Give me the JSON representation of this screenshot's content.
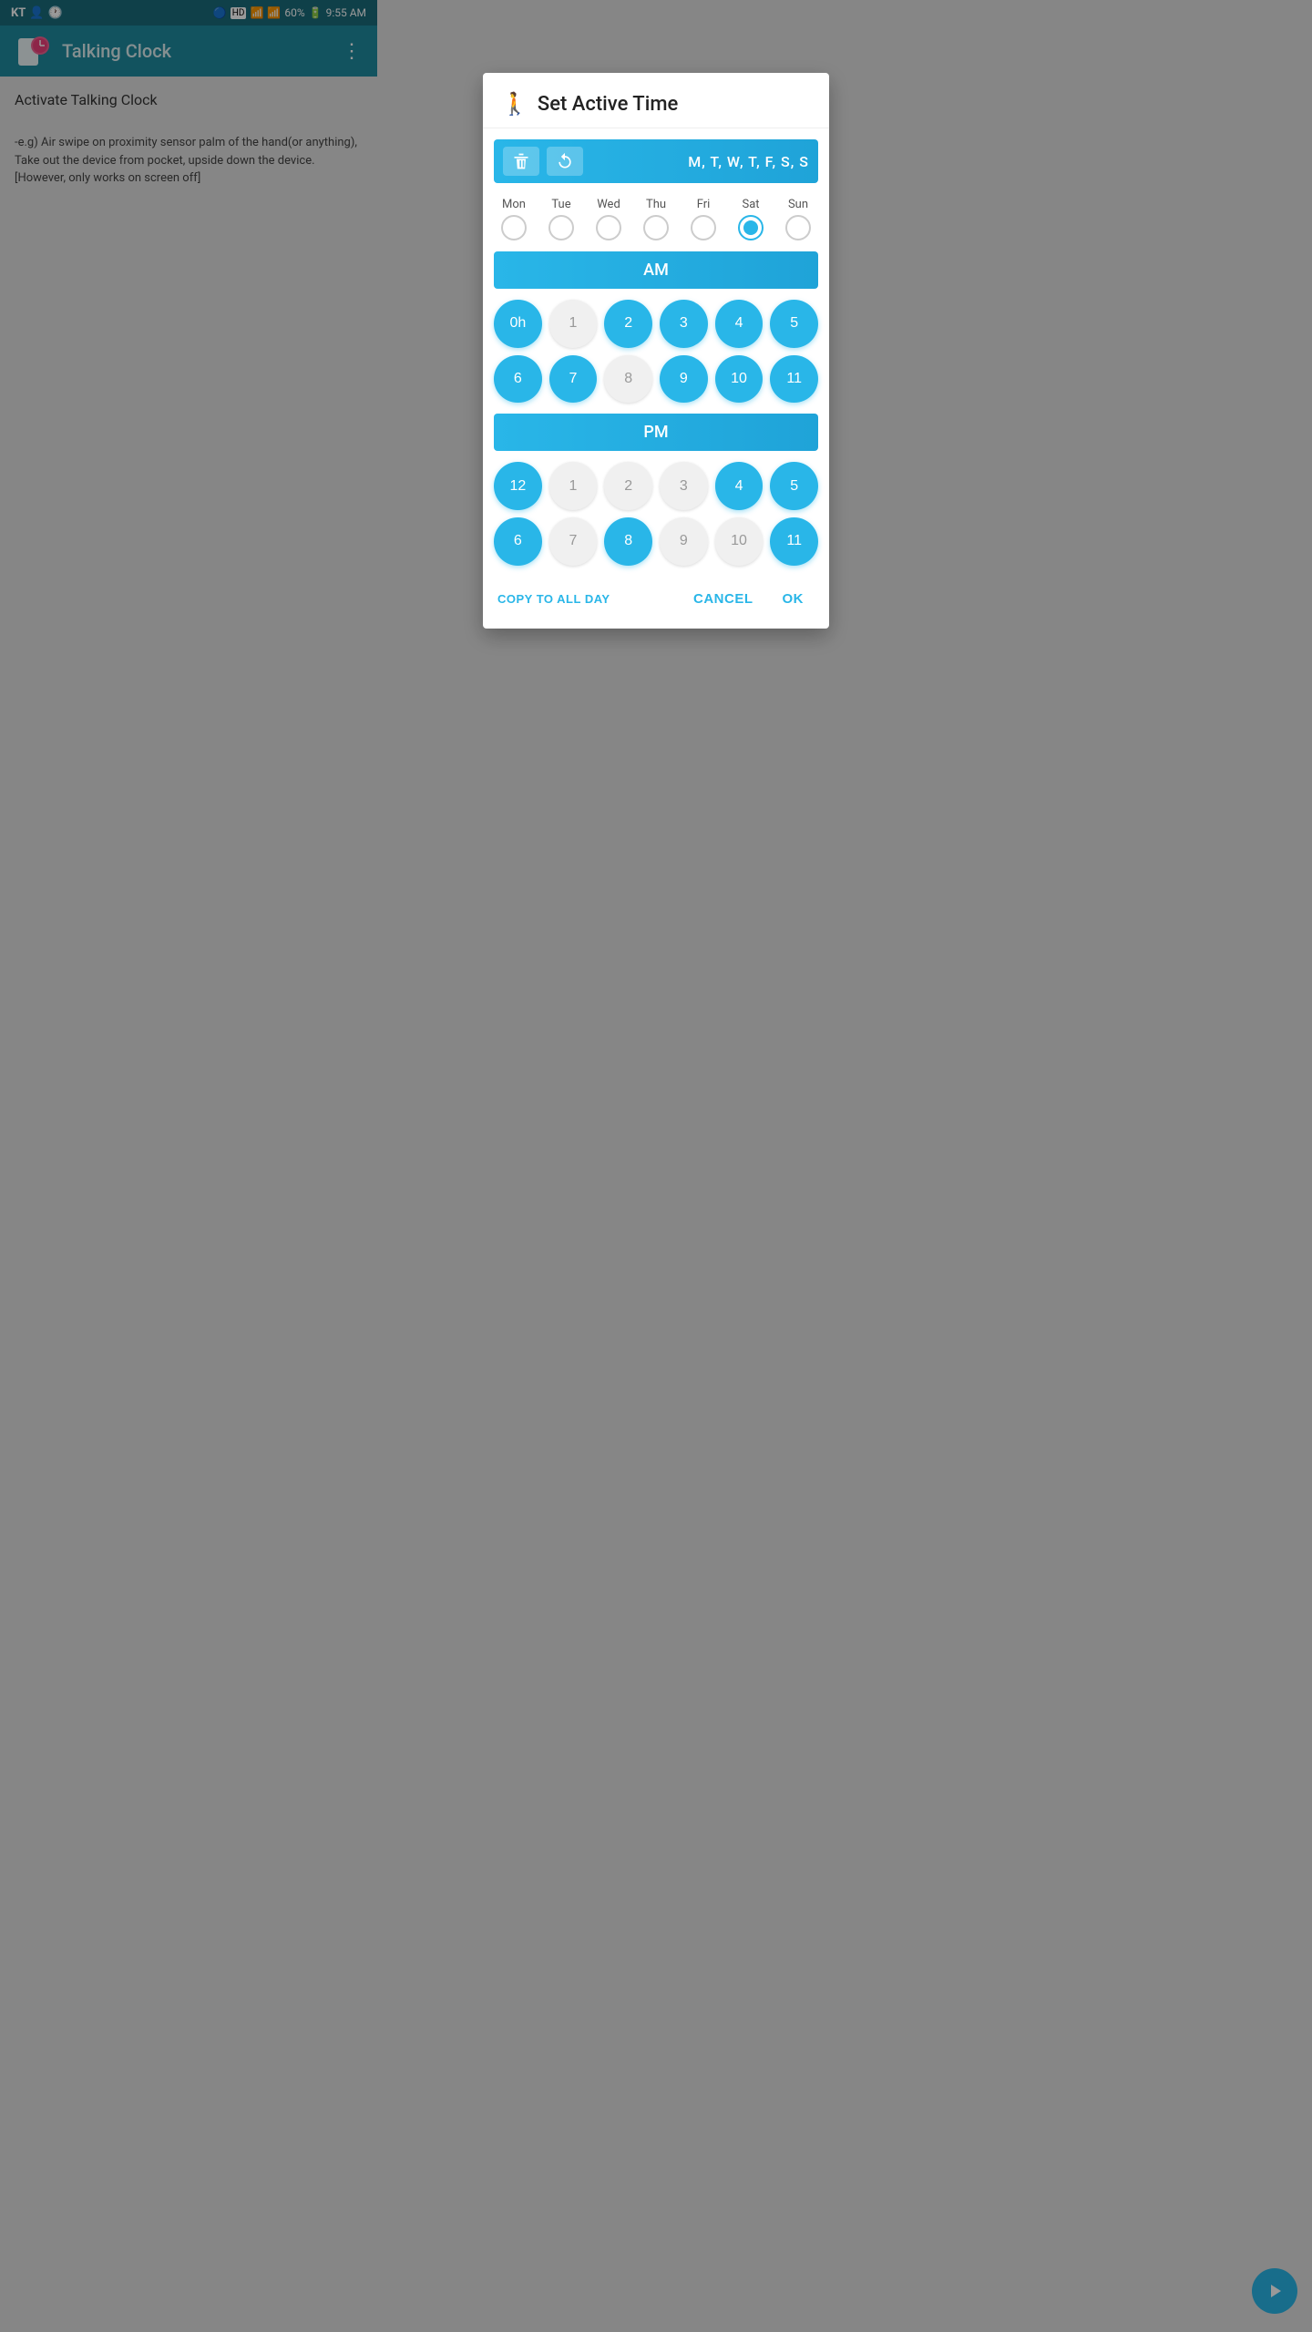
{
  "statusBar": {
    "left": "KT",
    "time": "9:55 AM",
    "battery": "60%"
  },
  "appBar": {
    "title": "Talking Clock",
    "menuIcon": "⋮"
  },
  "bgContent": {
    "label": "Activate Talking Clock"
  },
  "dialog": {
    "title": "Set Active Time",
    "walkIcon": "🚶",
    "daysLabel": "M, T, W, T, F, S, S",
    "deleteLabel": "delete",
    "resetLabel": "reset",
    "days": [
      {
        "label": "Mon",
        "selected": false
      },
      {
        "label": "Tue",
        "selected": false
      },
      {
        "label": "Wed",
        "selected": false
      },
      {
        "label": "Thu",
        "selected": false
      },
      {
        "label": "Fri",
        "selected": false
      },
      {
        "label": "Sat",
        "selected": true
      },
      {
        "label": "Sun",
        "selected": false
      }
    ],
    "amLabel": "AM",
    "amHours": [
      {
        "value": "0h",
        "active": true
      },
      {
        "value": "1",
        "active": false
      },
      {
        "value": "2",
        "active": true
      },
      {
        "value": "3",
        "active": true
      },
      {
        "value": "4",
        "active": true
      },
      {
        "value": "5",
        "active": true
      },
      {
        "value": "6",
        "active": true
      },
      {
        "value": "7",
        "active": true
      },
      {
        "value": "8",
        "active": false
      },
      {
        "value": "9",
        "active": true
      },
      {
        "value": "10",
        "active": true
      },
      {
        "value": "11",
        "active": true
      }
    ],
    "pmLabel": "PM",
    "pmHours": [
      {
        "value": "12",
        "active": true
      },
      {
        "value": "1",
        "active": false
      },
      {
        "value": "2",
        "active": false
      },
      {
        "value": "3",
        "active": false
      },
      {
        "value": "4",
        "active": true
      },
      {
        "value": "5",
        "active": true
      },
      {
        "value": "6",
        "active": true
      },
      {
        "value": "7",
        "active": false
      },
      {
        "value": "8",
        "active": true
      },
      {
        "value": "9",
        "active": false
      },
      {
        "value": "10",
        "active": false
      },
      {
        "value": "11",
        "active": true
      }
    ],
    "copyToAllDay": "COPY TO ALL DAY",
    "cancel": "CANCEL",
    "ok": "OK"
  },
  "bottomDesc": "-e.g) Air swipe on proximity sensor palm of the hand(or anything), Take out the device from pocket, upside down the device. [However, only works on screen off]"
}
